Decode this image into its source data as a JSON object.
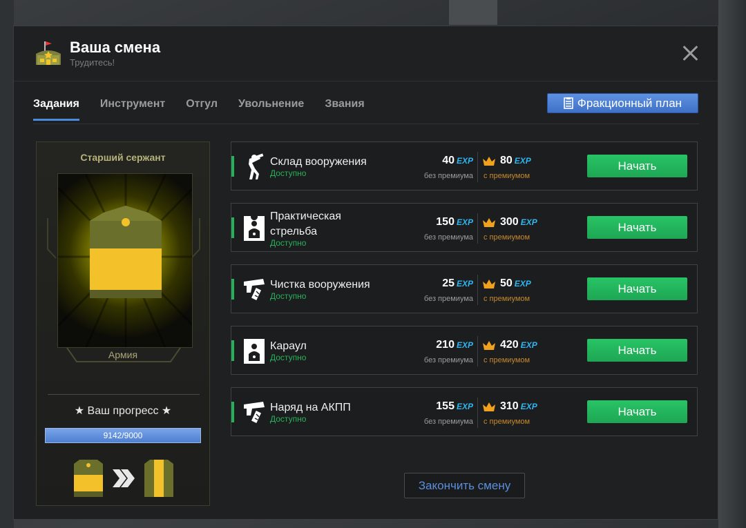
{
  "header": {
    "title": "Ваша смена",
    "subtitle": "Трудитесь!",
    "icon": "base-building-icon",
    "close_icon": "close-icon"
  },
  "tabs": [
    {
      "label": "Задания",
      "active": true
    },
    {
      "label": "Инструмент",
      "active": false
    },
    {
      "label": "Отгул",
      "active": false
    },
    {
      "label": "Увольнение",
      "active": false
    },
    {
      "label": "Звания",
      "active": false
    }
  ],
  "faction_plan_button": {
    "label": "Фракционный план",
    "icon": "clipboard-icon"
  },
  "rank_panel": {
    "rank_name": "Старший сержант",
    "faction": "Армия",
    "progress_label": "★ Ваш прогресс ★",
    "progress_current": 9142,
    "progress_max": 9000,
    "progress_text": "9142/9000"
  },
  "tasks": [
    {
      "name": "Склад вооружения",
      "status": "Доступно",
      "icon": "soldier-carrying-icon",
      "exp": "40",
      "exp_premium": "80",
      "no_premium_label": "без премиума",
      "premium_label": "с премиумом",
      "button": "Начать"
    },
    {
      "name": "Практическая стрельба",
      "status": "Доступно",
      "icon": "shooting-target-icon",
      "exp": "150",
      "exp_premium": "300",
      "no_premium_label": "без премиума",
      "premium_label": "с премиумом",
      "button": "Начать"
    },
    {
      "name": "Чистка вооружения",
      "status": "Доступно",
      "icon": "pistol-cleaning-icon",
      "exp": "25",
      "exp_premium": "50",
      "no_premium_label": "без премиума",
      "premium_label": "с премиумом",
      "button": "Начать"
    },
    {
      "name": "Караул",
      "status": "Доступно",
      "icon": "shooting-target-icon",
      "exp": "210",
      "exp_premium": "420",
      "no_premium_label": "без премиума",
      "premium_label": "с премиумом",
      "button": "Начать"
    },
    {
      "name": "Наряд на АКПП",
      "status": "Доступно",
      "icon": "pistol-cleaning-icon",
      "exp": "155",
      "exp_premium": "310",
      "no_premium_label": "без премиума",
      "premium_label": "с премиумом",
      "button": "Начать"
    }
  ],
  "exp_unit": "EXP",
  "finish_button": "Закончить смену",
  "colors": {
    "accent_blue": "#4a8adf",
    "available_green": "#27b35a",
    "start_button": "#23b25a",
    "exp_blue": "#2fb6f0",
    "premium_orange": "#c6882e",
    "rank_yellow": "#f3c22b",
    "rank_olive": "#6b6f2c"
  }
}
